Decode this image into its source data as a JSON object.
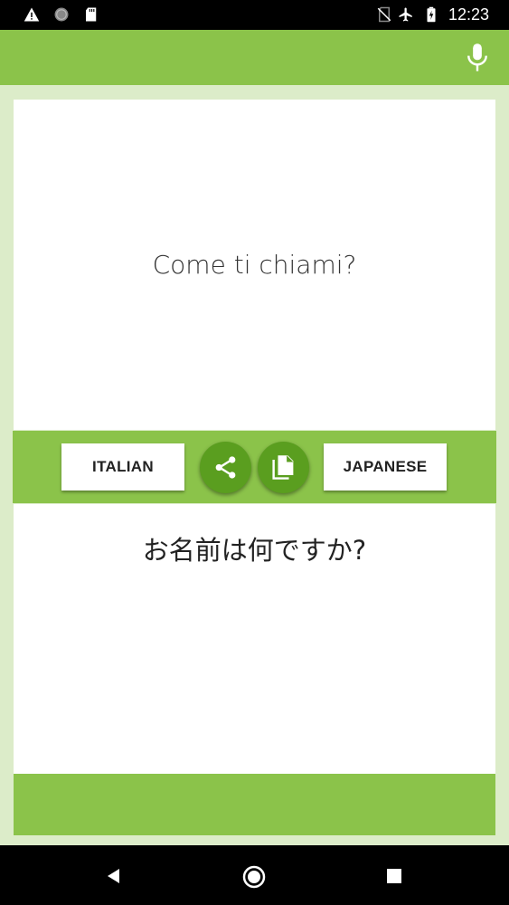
{
  "status_bar": {
    "time": "12:23",
    "icons": [
      "warning-icon",
      "circle-status-icon",
      "sd-card-icon",
      "no-sim-icon",
      "airplane-mode-icon",
      "battery-charging-icon"
    ]
  },
  "toolbar": {
    "mic_icon": "microphone-icon"
  },
  "source": {
    "text": "Come ti chiami?"
  },
  "controls": {
    "source_language": "ITALIAN",
    "target_language": "JAPANESE",
    "share_icon": "share-icon",
    "copy_icon": "copy-icon"
  },
  "translation": {
    "text": "お名前は何ですか?"
  },
  "nav_bar": {
    "icons": [
      "back-icon",
      "home-icon",
      "recents-icon"
    ]
  },
  "colors": {
    "accent": "#8bc34a",
    "accent_dark": "#5a9e1f",
    "background": "#dcecc9"
  }
}
